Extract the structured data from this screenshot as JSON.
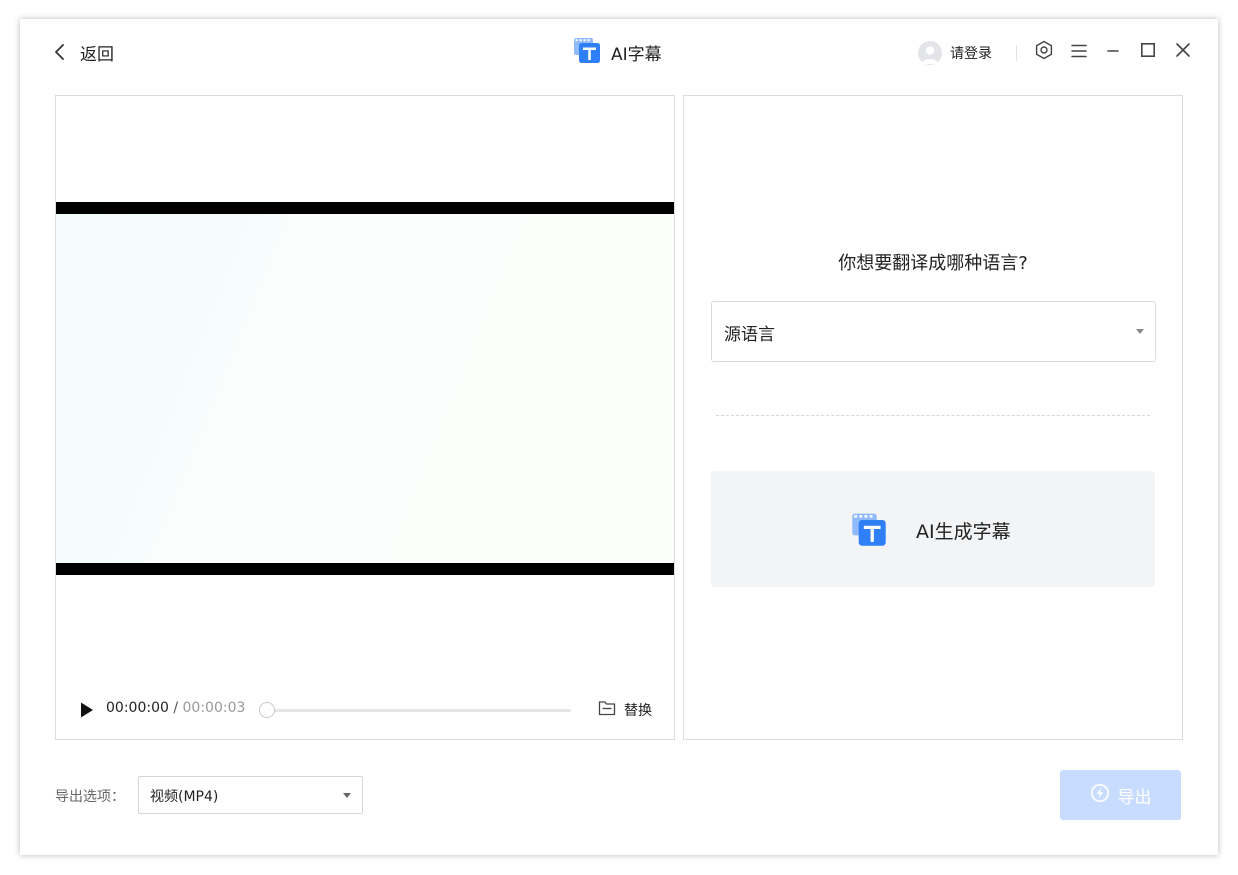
{
  "header": {
    "back_label": "返回",
    "title": "AI字幕",
    "login_label": "请登录"
  },
  "icons": {
    "back": "chevron-left-icon",
    "app": "subtitle-icon",
    "avatar": "user-avatar-icon",
    "settings": "gear-icon",
    "menu": "hamburger-menu-icon",
    "minimize": "minimize-icon",
    "maximize": "maximize-icon",
    "close": "close-icon",
    "play": "play-icon",
    "replace": "folder-icon",
    "export": "export-icon"
  },
  "player": {
    "current_time": "00:00:00",
    "divider": " / ",
    "total_time": "00:00:03",
    "progress": 0,
    "replace_label": "替换"
  },
  "translate": {
    "question": "你想要翻译成哪种语言?",
    "language_value": "源语言",
    "generate_label": "AI生成字幕"
  },
  "footer": {
    "export_option_label": "导出选项：",
    "export_format": "视频(MP4)",
    "export_button_label": "导出"
  },
  "colors": {
    "accent": "#2f7ff8",
    "export_button_disabled": "#c8dcff",
    "generate_button_bg": "#f3f4f6"
  }
}
